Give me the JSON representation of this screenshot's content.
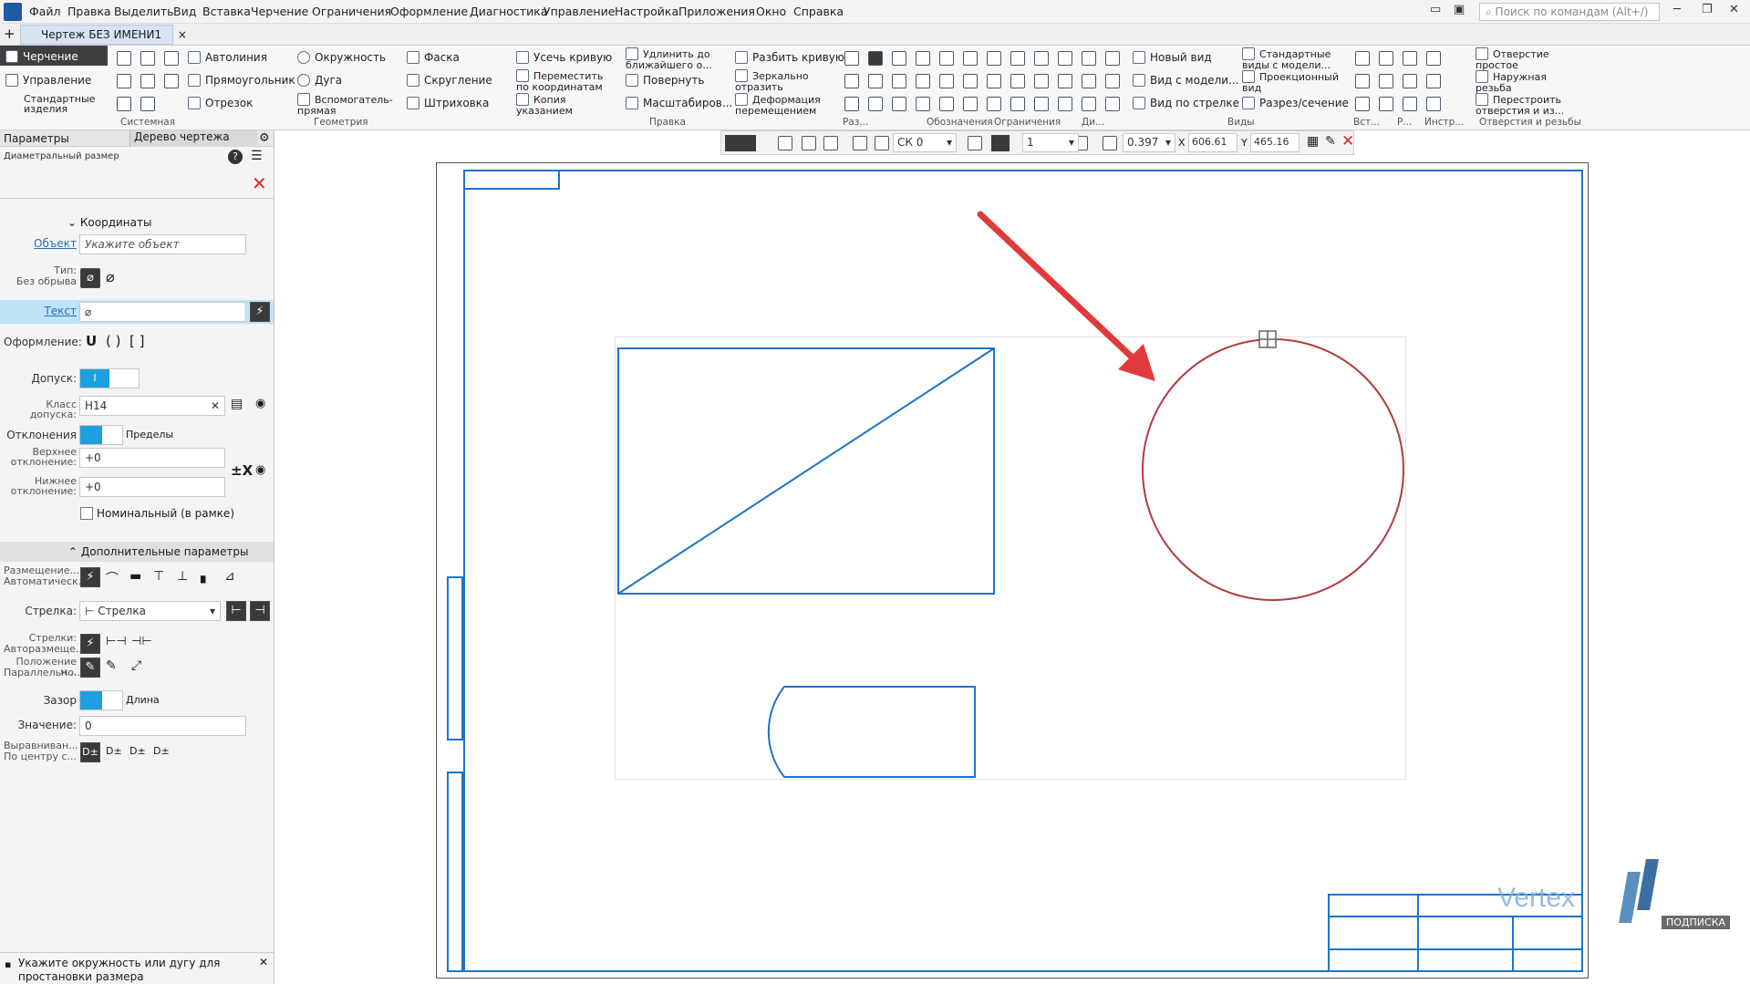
{
  "menu": [
    "Файл",
    "Правка",
    "Выделить",
    "Вид",
    "Вставка",
    "Черчение",
    "Ограничения",
    "Оформление",
    "Диагностика",
    "Управление",
    "Настройка",
    "Приложения",
    "Окно",
    "Справка"
  ],
  "search_placeholder": "Поиск по командам (Alt+/)",
  "doc_tab": "Чертеж БЕЗ ИМЕНИ1",
  "doc_tab_close": "×",
  "ribbon": {
    "left_tabs": [
      "Черчение",
      "Управление",
      "Стандартные изделия"
    ],
    "geometry": [
      "Автолиния",
      "Прямоугольник",
      "Отрезок",
      "Окружность",
      "Дуга",
      "Вспомогатель- прямая",
      "Фаска",
      "Скругление",
      "Штриховка"
    ],
    "edit": [
      "Усечь кривую",
      "Переместить по координатам",
      "Копия указанием",
      "Удлинить до ближайшего о...",
      "Повернуть",
      "Масштабиров...",
      "Разбить кривую",
      "Зеркально отразить",
      "Деформация перемещением"
    ],
    "views": [
      "Новый вид",
      "Вид с модели...",
      "Вид по стрелке",
      "Стандартные виды с модели...",
      "Проекционный вид",
      "Разрез/сечение"
    ],
    "holes": [
      "Отверстие простое",
      "Наружная резьба",
      "Перестроить отверстия и из..."
    ],
    "groups": [
      "Системная",
      "Геометрия",
      "Правка",
      "Раз...",
      "Обозначения",
      "Ограничения",
      "Ди...",
      "Виды",
      "Вст...",
      "Р...",
      "Инстр...",
      "Отверстия и резьбы"
    ]
  },
  "toolbar": {
    "cs": "СК 0",
    "layer": "1",
    "zoom": "0.397",
    "x_label": "X",
    "x": "606.61",
    "y_label": "Y",
    "y": "465.16"
  },
  "panel": {
    "tab_params": "Параметры",
    "tab_tree": "Дерево чертежа",
    "help_icon": "?",
    "subtitle": "Диаметральный размер",
    "section_coords": "Координаты",
    "object_label": "Объект",
    "object_placeholder": "Укажите объект",
    "type_label": "Тип:",
    "type_value": "Без обрыва",
    "text_label": "Текст",
    "text_value": "⌀",
    "design_label": "Оформление:",
    "design_opts": [
      "U",
      "( )",
      "[ ]"
    ],
    "tolerance_label": "Допуск:",
    "tol_class_label": "Класс допуска:",
    "tol_class_value": "H14",
    "deviations_label": "Отклонения",
    "limits_label": "Пределы",
    "upper_label": "Верхнее отклонение:",
    "upper_value": "+0",
    "lower_label": "Нижнее отклонение:",
    "lower_value": "+0",
    "x_icon": "±X",
    "nominal_label": "Номинальный (в рамке)",
    "section_extra": "Дополнительные параметры",
    "placement_label": "Размещение...",
    "placement_sub": "Автоматическ...",
    "arrow_label": "Стрелка:",
    "arrow_value": "Стрелка",
    "arrows_label": "Стрелки:",
    "arrows_sub": "Авторазмеще...",
    "position_label": "Положение н...",
    "position_sub": "Параллельно...",
    "gap_label": "Зазор",
    "length_label": "Длина",
    "value_label": "Значение:",
    "value_value": "0",
    "align_label": "Выравниван...",
    "align_sub": "По центру с...",
    "align_opts": [
      "D±",
      "D±",
      "D±",
      "D±"
    ]
  },
  "status_hint": "Укажите окружность или дугу для простановки размера",
  "watermark": {
    "brand": "Vertex",
    "badge": "ПОДПИСКА"
  },
  "colors": {
    "accent": "#1e9fe0",
    "frame": "#1e74c8",
    "circle": "#b53a3a",
    "arrow": "#e03a3a"
  }
}
